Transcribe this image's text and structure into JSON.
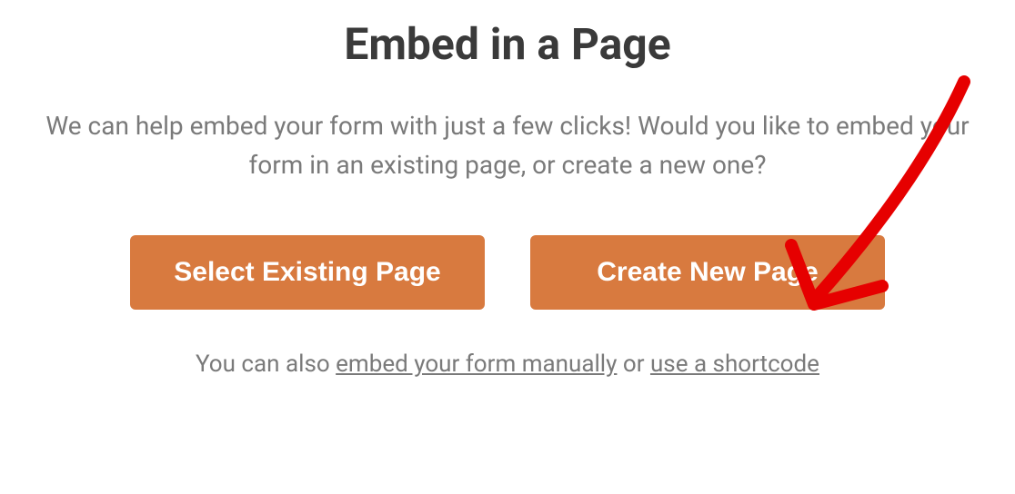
{
  "heading": "Embed in a Page",
  "description": "We can help embed your form with just a few clicks! Would you like to embed your form in an existing page, or create a new one?",
  "buttons": {
    "select_existing": "Select Existing Page",
    "create_new": "Create New Page"
  },
  "footer": {
    "prefix": "You can also ",
    "link_manual": "embed your form manually",
    "middle": " or ",
    "link_shortcode": "use a shortcode"
  },
  "annotation": {
    "color": "#e60000",
    "target": "create-new-page-button"
  }
}
